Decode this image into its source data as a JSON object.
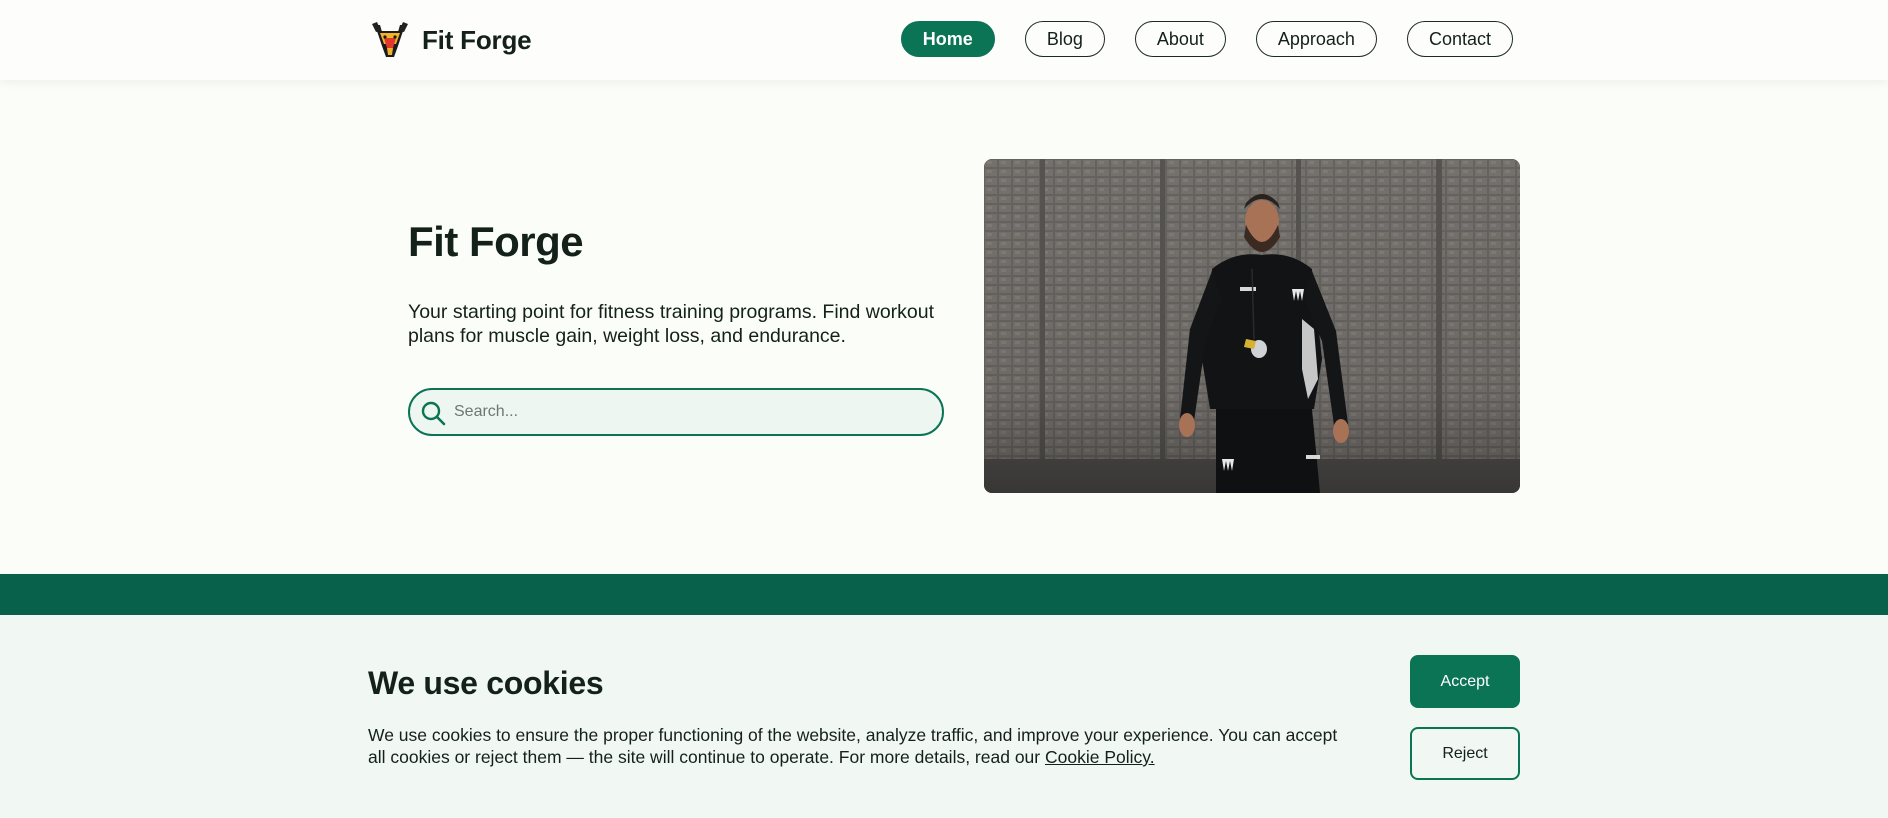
{
  "header": {
    "brand_name": "Fit Forge",
    "logo_icon": "bull-head-logo",
    "nav": [
      {
        "label": "Home",
        "active": true
      },
      {
        "label": "Blog",
        "active": false
      },
      {
        "label": "About",
        "active": false
      },
      {
        "label": "Approach",
        "active": false
      },
      {
        "label": "Contact",
        "active": false
      }
    ]
  },
  "hero": {
    "title": "Fit Forge",
    "subtitle": "Your starting point for fitness training programs. Find workout plans for muscle gain, weight loss, and endurance.",
    "search": {
      "placeholder": "Search...",
      "value": "",
      "icon": "search-icon"
    },
    "photo": {
      "subject": "bearded coach in black tracksuit with whistle in front of a stone wall"
    }
  },
  "cookie": {
    "title": "We use cookies",
    "text": "We use cookies to ensure the proper functioning of the website, analyze traffic, and improve your experience. You can accept all cookies or reject them — the site will continue to operate. For more details, read our ",
    "link_label": "Cookie Policy.",
    "accept_label": "Accept",
    "reject_label": "Reject"
  },
  "colors": {
    "primary": "#0a7455",
    "band": "#08614a",
    "page_bg": "#fbfdf9",
    "cookie_bg": "#f1f7f3",
    "text": "#14211b"
  }
}
